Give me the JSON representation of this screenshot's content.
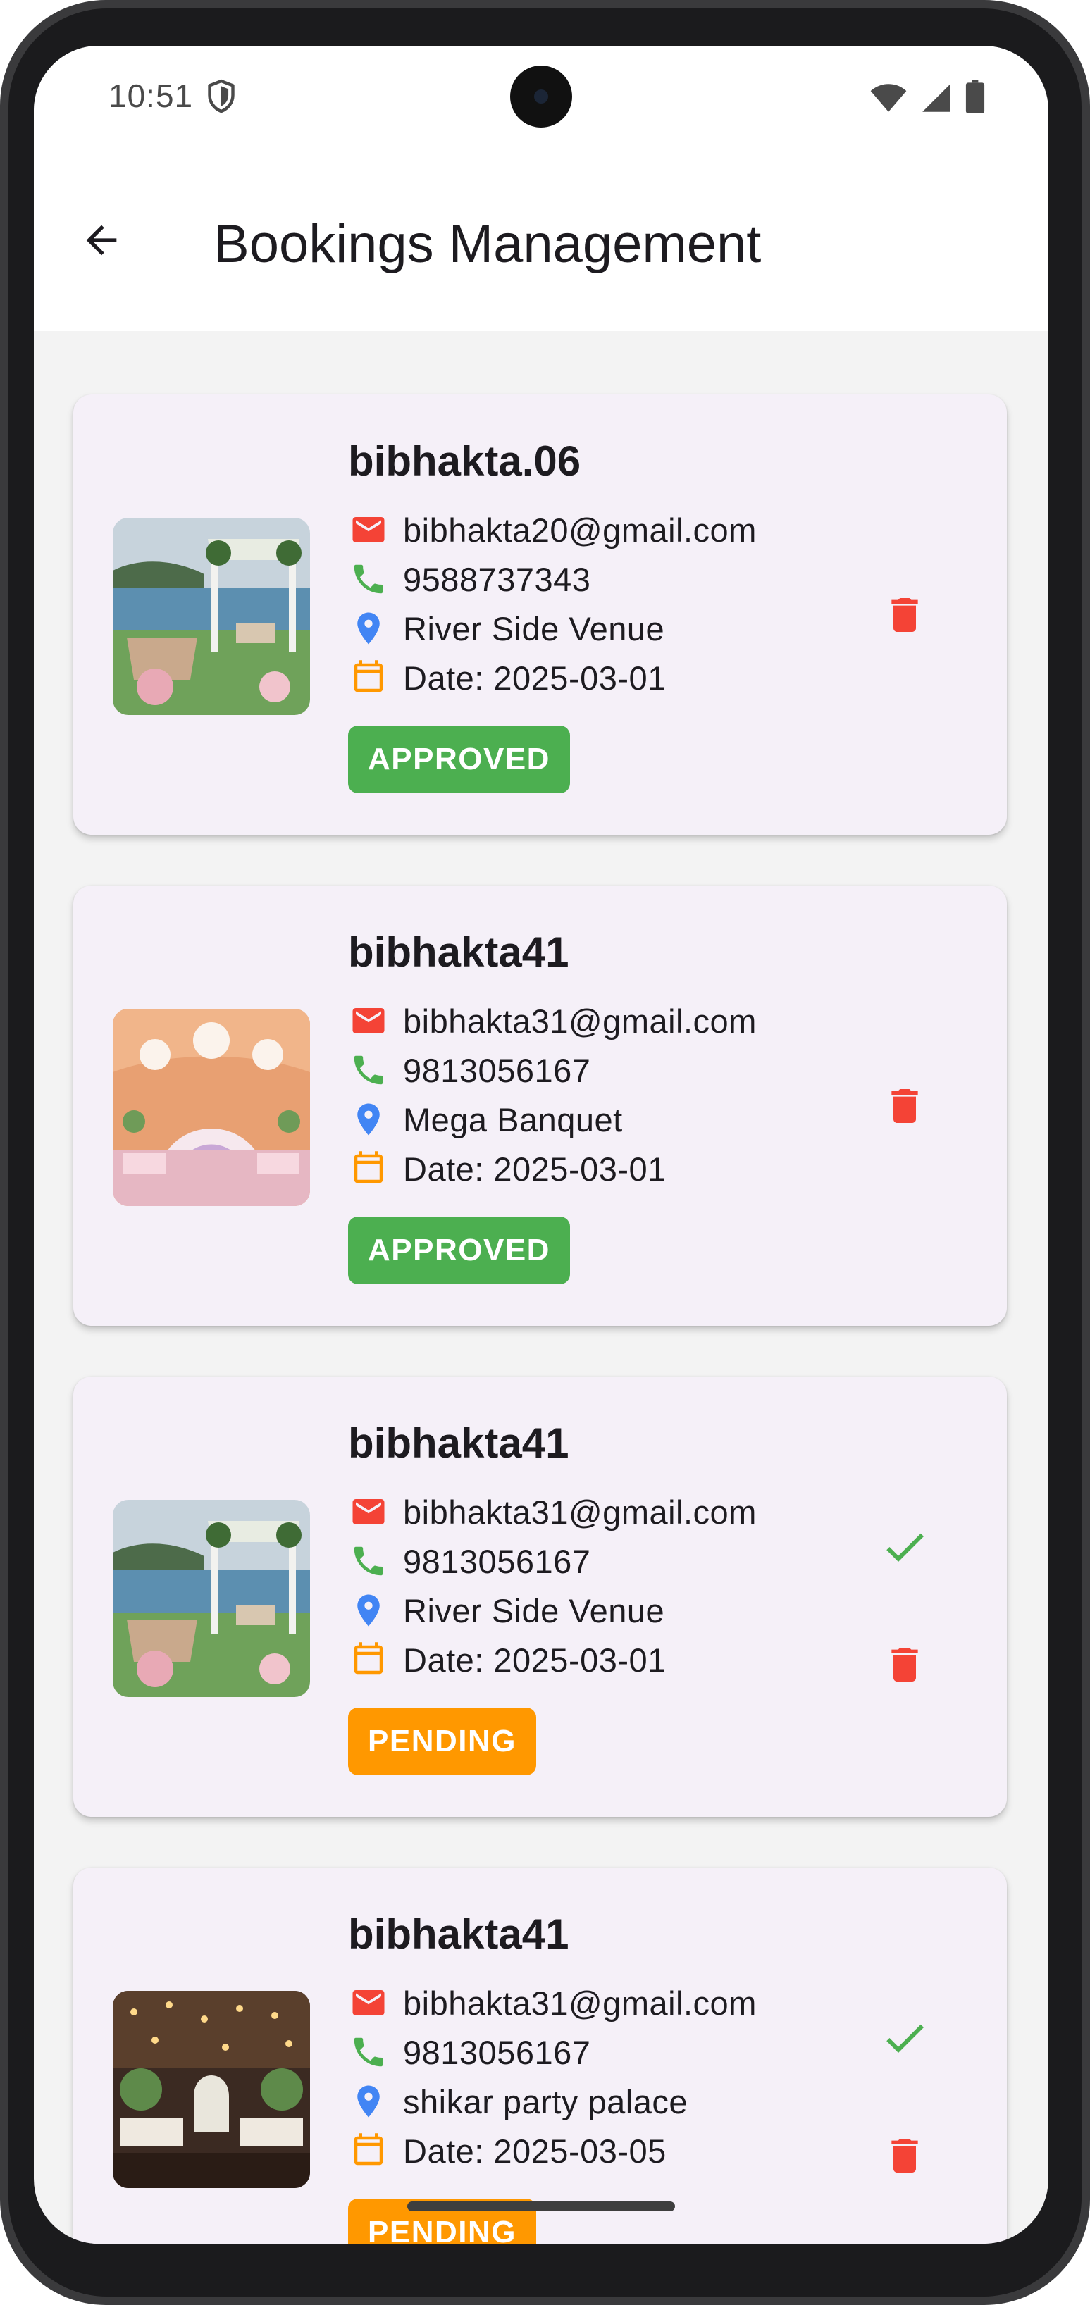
{
  "status_bar": {
    "time": "10:51",
    "icons": [
      "shield-icon",
      "wifi-icon",
      "cell-signal-icon",
      "battery-icon"
    ]
  },
  "app_bar": {
    "back_icon": "arrow-left-icon",
    "title": "Bookings Management"
  },
  "colors": {
    "approved": "#4caf50",
    "pending": "#ff9800",
    "delete": "#f44336",
    "approve_check": "#4caf50",
    "email_icon": "#f44336",
    "phone_icon": "#4caf50",
    "location_icon": "#4285f4",
    "calendar_icon": "#ff9800",
    "card_bg": "#f5f0f8"
  },
  "bookings": [
    {
      "username": "bibhakta.06",
      "email": "bibhakta20@gmail.com",
      "phone": "9588737343",
      "venue": "River Side Venue",
      "date": "Date: 2025-03-01",
      "status": "APPROVED",
      "actions": [
        "delete-icon"
      ]
    },
    {
      "username": "bibhakta41",
      "email": "bibhakta31@gmail.com",
      "phone": "9813056167",
      "venue": "Mega Banquet",
      "date": "Date: 2025-03-01",
      "status": "APPROVED",
      "actions": [
        "delete-icon"
      ]
    },
    {
      "username": "bibhakta41",
      "email": "bibhakta31@gmail.com",
      "phone": "9813056167",
      "venue": "River Side Venue",
      "date": "Date: 2025-03-01",
      "status": "PENDING",
      "actions": [
        "check-icon",
        "delete-icon"
      ]
    },
    {
      "username": "bibhakta41",
      "email": "bibhakta31@gmail.com",
      "phone": "9813056167",
      "venue": "shikar party palace",
      "date": "Date: 2025-03-05",
      "status": "PENDING",
      "actions": [
        "check-icon",
        "delete-icon"
      ]
    }
  ]
}
